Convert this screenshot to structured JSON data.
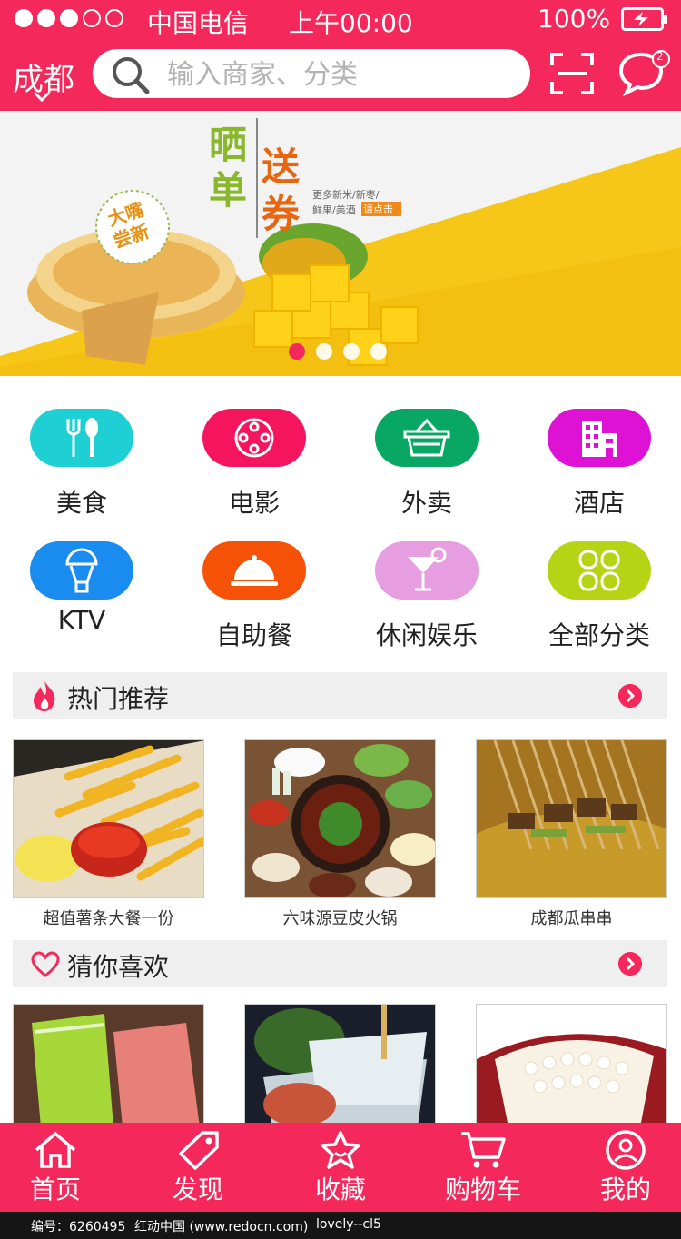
{
  "status_bar": {
    "carrier": "中国电信",
    "time": "上午00:00",
    "battery": "100%"
  },
  "header": {
    "city": "成都",
    "search_placeholder": "输入商家、分类",
    "message_count": "2"
  },
  "banner": {
    "main_text": [
      "晒",
      "单",
      "送",
      "券"
    ],
    "badge_text": [
      "大嘴",
      "尝新"
    ],
    "sub_text": [
      "更多新米/新枣/",
      "鲜果/美酒"
    ],
    "cta": "请点击",
    "page_count": 4,
    "active_page": 1
  },
  "categories": [
    {
      "label": "美食",
      "icon": "fork-spoon-icon",
      "color": "#1ecfd4"
    },
    {
      "label": "电影",
      "icon": "film-reel-icon",
      "color": "#f5155e"
    },
    {
      "label": "外卖",
      "icon": "basket-icon",
      "color": "#08a864"
    },
    {
      "label": "酒店",
      "icon": "hotel-icon",
      "color": "#de12d4"
    },
    {
      "label": "KTV",
      "icon": "microphone-icon",
      "color": "#1a8cf0"
    },
    {
      "label": "自助餐",
      "icon": "food-cloche-icon",
      "color": "#f55207"
    },
    {
      "label": "休闲娱乐",
      "icon": "cocktail-icon",
      "color": "#e69ee0"
    },
    {
      "label": "全部分类",
      "icon": "grid-icon",
      "color": "#b6d416"
    }
  ],
  "hot": {
    "title": "热门推荐",
    "items": [
      {
        "title": "超值薯条大餐一份"
      },
      {
        "title": "六味源豆皮火锅"
      },
      {
        "title": "成都瓜串串"
      }
    ]
  },
  "guess": {
    "title": "猜你喜欢"
  },
  "tabs": [
    {
      "label": "首页",
      "icon": "home-icon"
    },
    {
      "label": "发现",
      "icon": "tag-icon"
    },
    {
      "label": "收藏",
      "icon": "star-icon"
    },
    {
      "label": "购物车",
      "icon": "cart-icon"
    },
    {
      "label": "我的",
      "icon": "user-icon"
    }
  ],
  "footer": {
    "id": "编号：6260495",
    "site": "红动中国 (www.redocn.com)",
    "author": "lovely--cl5"
  },
  "colors": {
    "brand": "#f5285b",
    "section_bg": "#efefef"
  }
}
